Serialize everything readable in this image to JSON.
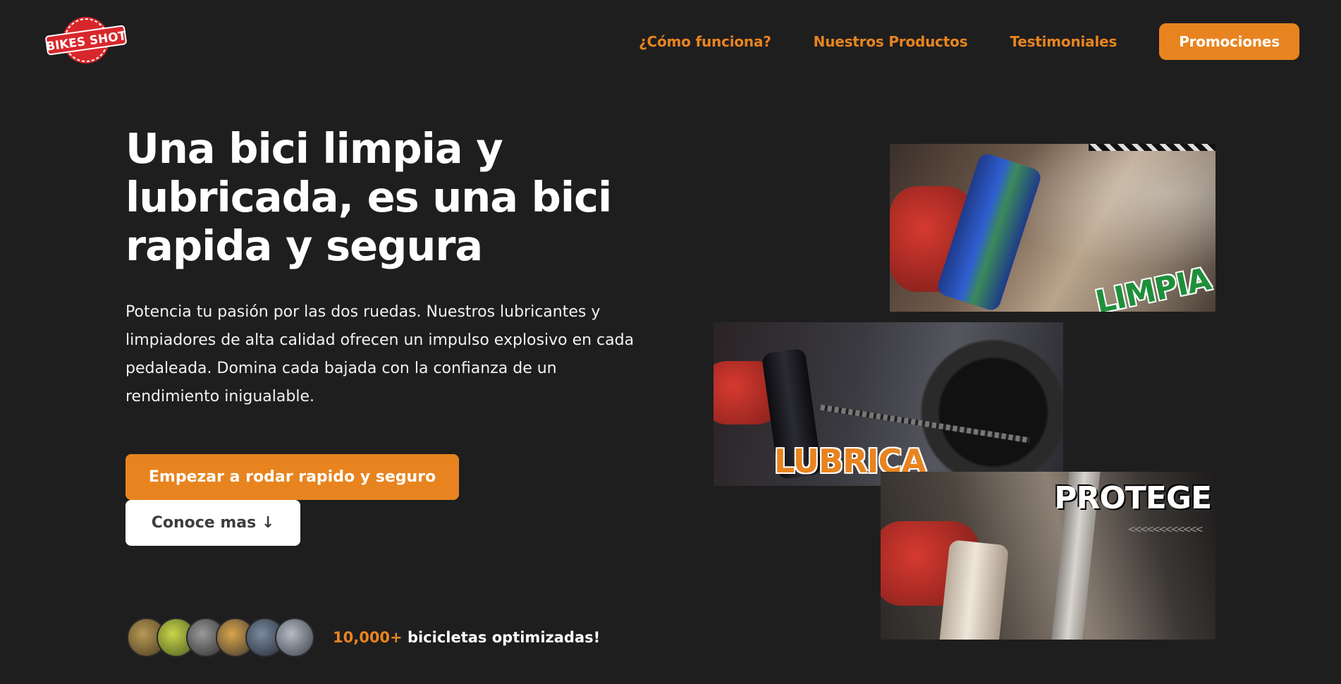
{
  "header": {
    "logo_text": "BIKES SHOT",
    "nav": [
      {
        "label": "¿Cómo funciona?"
      },
      {
        "label": "Nuestros Productos"
      },
      {
        "label": "Testimoniales"
      }
    ],
    "promo_label": "Promociones"
  },
  "hero": {
    "title": "Una bici limpia y lubricada, es una bici rapida y segura",
    "text": "Potencia tu pasión por las dos ruedas. Nuestros lubricantes y limpiadores de alta calidad ofrecen un impulso explosivo en cada pedaleada. Domina cada bajada con la confianza de un rendimiento inigualable.",
    "primary_button": "Empezar a rodar rapido y seguro",
    "secondary_button": "Conoce mas ↓"
  },
  "social_proof": {
    "count": "10,000+",
    "text": " bicicletas optimizadas!",
    "avatars": 6
  },
  "collage": {
    "photo_1_label": "LIMPIA",
    "photo_2_label": "LUBRICA",
    "photo_3_label": "PROTEGE",
    "chevrons": "<<<<<<<<<<<<"
  },
  "colors": {
    "background": "#1e1e1f",
    "accent": "#e8841f",
    "text": "#ffffff"
  }
}
